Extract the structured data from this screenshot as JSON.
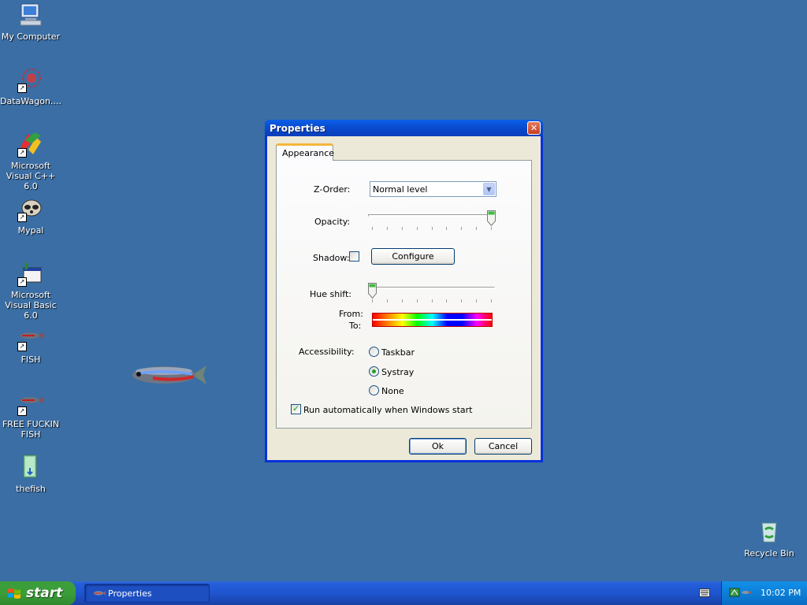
{
  "desktop": {
    "background": "#3a6ea5",
    "icons": [
      {
        "label": "My Computer",
        "icon": "computer-icon"
      },
      {
        "label": "DataWagon....",
        "icon": "datawagon-icon"
      },
      {
        "label": "Microsoft Visual C++ 6.0",
        "icon": "visual-cpp-icon"
      },
      {
        "label": "Mypal",
        "icon": "mypal-icon"
      },
      {
        "label": "Microsoft Visual Basic 6.0",
        "icon": "visual-basic-icon"
      },
      {
        "label": "FISH",
        "icon": "fish-icon"
      },
      {
        "label": "FREE FUCKIN FISH",
        "icon": "fish-icon"
      },
      {
        "label": "thefish",
        "icon": "folder-icon"
      },
      {
        "label": "Recycle Bin",
        "icon": "recycle-bin-icon"
      }
    ]
  },
  "window": {
    "title": "Properties",
    "close_glyph": "✕",
    "tab_label": "Appearance",
    "zorder": {
      "label": "Z-Order:",
      "value": "Normal level"
    },
    "opacity": {
      "label": "Opacity:",
      "value": 1.0
    },
    "shadow": {
      "label": "Shadow:",
      "checked": false,
      "button_label": "Configure"
    },
    "hue_shift": {
      "label": "Hue shift:",
      "value": 0.0,
      "from_label": "From:",
      "to_label": "To:"
    },
    "accessibility": {
      "label": "Accessibility:",
      "options": [
        {
          "label": "Taskbar",
          "selected": false
        },
        {
          "label": "Systray",
          "selected": true
        },
        {
          "label": "None",
          "selected": false
        }
      ]
    },
    "autorun": {
      "label": "Run automatically when Windows start",
      "checked": true
    },
    "ok_label": "Ok",
    "cancel_label": "Cancel"
  },
  "taskbar": {
    "start_label": "start",
    "task_label": "Properties",
    "clock": "10:02 PM"
  }
}
